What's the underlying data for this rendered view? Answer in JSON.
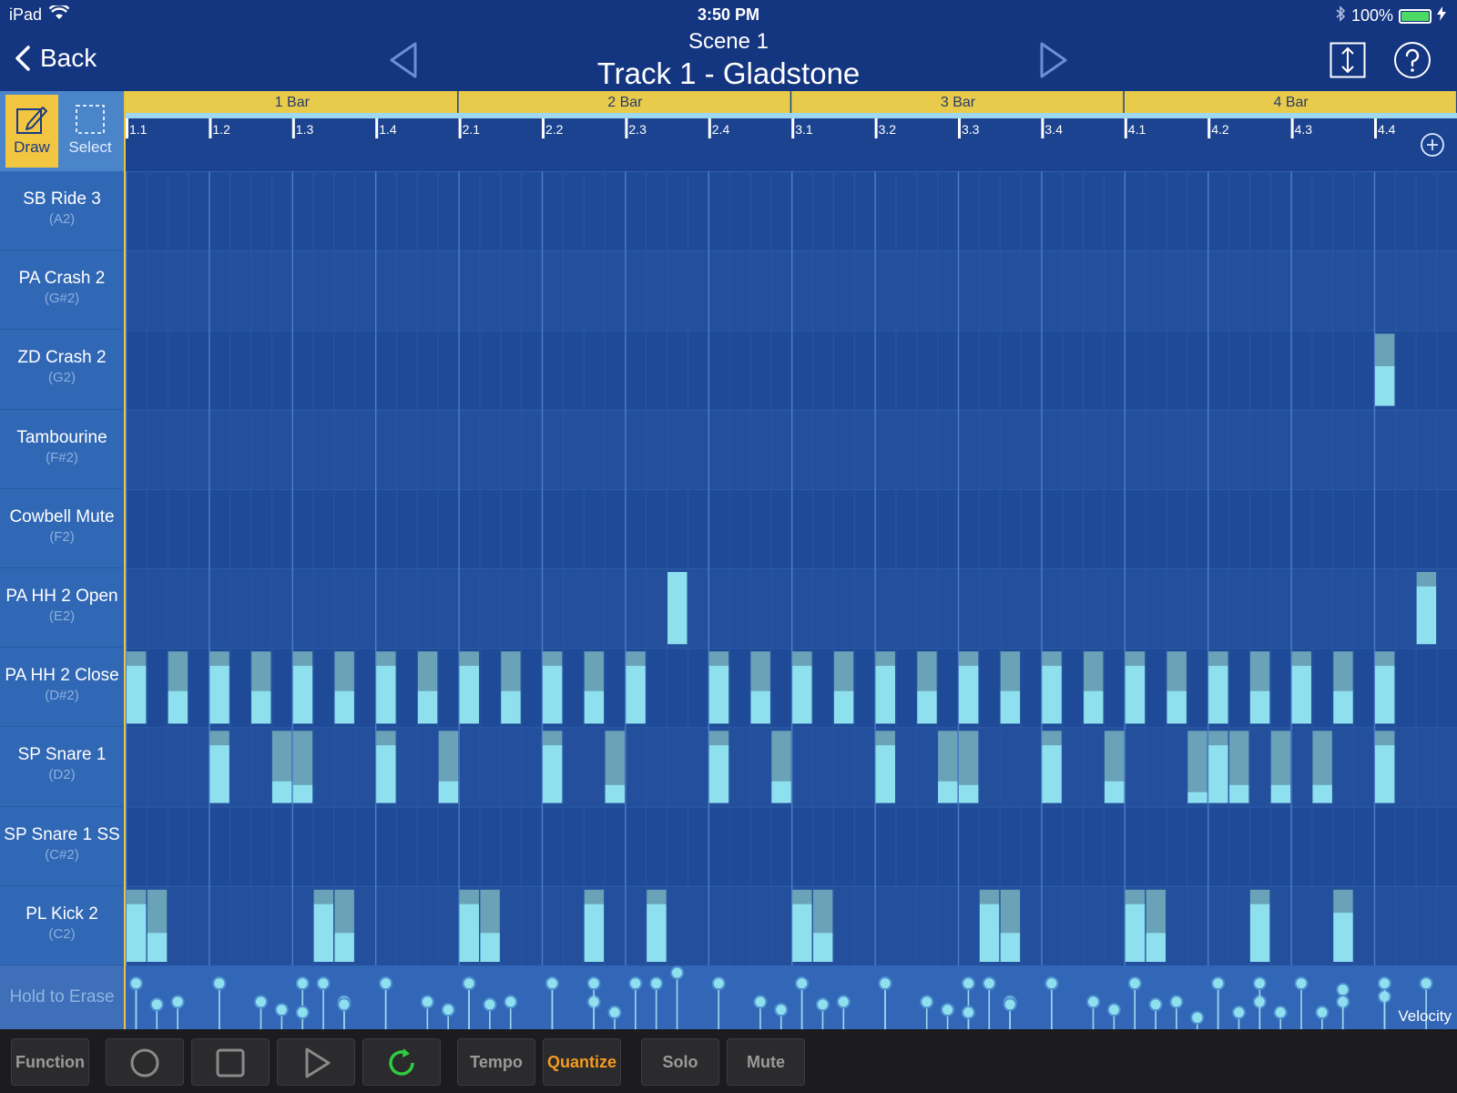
{
  "status": {
    "device": "iPad",
    "time": "3:50 PM",
    "battery": "100%"
  },
  "nav": {
    "back_label": "Back",
    "scene": "Scene  1",
    "track": "Track 1 - Gladstone"
  },
  "tools": {
    "draw_label": "Draw",
    "select_label": "Select"
  },
  "bars": [
    "1 Bar",
    "2 Bar",
    "3 Bar",
    "4 Bar"
  ],
  "beats": [
    "1.1",
    "1.2",
    "1.3",
    "1.4",
    "2.1",
    "2.2",
    "2.3",
    "2.4",
    "3.1",
    "3.2",
    "3.3",
    "3.4",
    "4.1",
    "4.2",
    "4.3",
    "4.4"
  ],
  "instruments": [
    {
      "name": "SB Ride 3",
      "note": "(A2)"
    },
    {
      "name": "PA Crash 2",
      "note": "(G#2)"
    },
    {
      "name": "ZD Crash 2",
      "note": "(G2)"
    },
    {
      "name": "Tambourine",
      "note": "(F#2)"
    },
    {
      "name": "Cowbell Mute",
      "note": "(F2)"
    },
    {
      "name": "PA HH 2 Open",
      "note": "(E2)"
    },
    {
      "name": "PA HH 2 Close",
      "note": "(D#2)"
    },
    {
      "name": "SP Snare 1",
      "note": "(D2)"
    },
    {
      "name": "SP Snare 1 SS",
      "note": "(C#2)"
    },
    {
      "name": "PL Kick 2",
      "note": "(C2)"
    }
  ],
  "notes": {
    "ZD Crash 2": [
      [
        60,
        0.55
      ]
    ],
    "PA HH 2 Open": [
      [
        26,
        1.0
      ],
      [
        62,
        0.8
      ]
    ],
    "PA HH 2 Close": [
      [
        0,
        0.8
      ],
      [
        2,
        0.45
      ],
      [
        4,
        0.8
      ],
      [
        6,
        0.45
      ],
      [
        8,
        0.8
      ],
      [
        10,
        0.45
      ],
      [
        12,
        0.8
      ],
      [
        14,
        0.45
      ],
      [
        16,
        0.8
      ],
      [
        18,
        0.45
      ],
      [
        20,
        0.8
      ],
      [
        22,
        0.45
      ],
      [
        24,
        0.8
      ],
      [
        28,
        0.8
      ],
      [
        30,
        0.45
      ],
      [
        32,
        0.8
      ],
      [
        34,
        0.45
      ],
      [
        36,
        0.8
      ],
      [
        38,
        0.45
      ],
      [
        40,
        0.8
      ],
      [
        42,
        0.45
      ],
      [
        44,
        0.8
      ],
      [
        46,
        0.45
      ],
      [
        48,
        0.8
      ],
      [
        50,
        0.45
      ],
      [
        52,
        0.8
      ],
      [
        54,
        0.45
      ],
      [
        56,
        0.8
      ],
      [
        58,
        0.45
      ],
      [
        60,
        0.8
      ]
    ],
    "SP Snare 1": [
      [
        4,
        0.8
      ],
      [
        7,
        0.3
      ],
      [
        8,
        0.25
      ],
      [
        12,
        0.8
      ],
      [
        15,
        0.3
      ],
      [
        20,
        0.8
      ],
      [
        23,
        0.25
      ],
      [
        28,
        0.8
      ],
      [
        31,
        0.3
      ],
      [
        36,
        0.8
      ],
      [
        39,
        0.3
      ],
      [
        40,
        0.25
      ],
      [
        44,
        0.8
      ],
      [
        47,
        0.3
      ],
      [
        51,
        0.15
      ],
      [
        52,
        0.8
      ],
      [
        53,
        0.25
      ],
      [
        55,
        0.25
      ],
      [
        57,
        0.25
      ],
      [
        60,
        0.8
      ]
    ],
    "PL Kick 2": [
      [
        0,
        0.8
      ],
      [
        1,
        0.4
      ],
      [
        9,
        0.8
      ],
      [
        10,
        0.4
      ],
      [
        16,
        0.8
      ],
      [
        17,
        0.4
      ],
      [
        22,
        0.8
      ],
      [
        25,
        0.8
      ],
      [
        32,
        0.8
      ],
      [
        33,
        0.4
      ],
      [
        41,
        0.8
      ],
      [
        42,
        0.4
      ],
      [
        48,
        0.8
      ],
      [
        49,
        0.4
      ],
      [
        54,
        0.8
      ],
      [
        58,
        0.68
      ]
    ]
  },
  "erase_label": "Hold to Erase",
  "velocity_label": "Velocity",
  "bottom": {
    "function": "Function",
    "tempo": "Tempo",
    "quantize": "Quantize",
    "solo": "Solo",
    "mute": "Mute"
  },
  "colors": {
    "accent_yellow": "#f2c640",
    "quantize_orange": "#f59a23",
    "note_cyan": "#8ee0ef",
    "loop_green": "#2ecc40"
  }
}
